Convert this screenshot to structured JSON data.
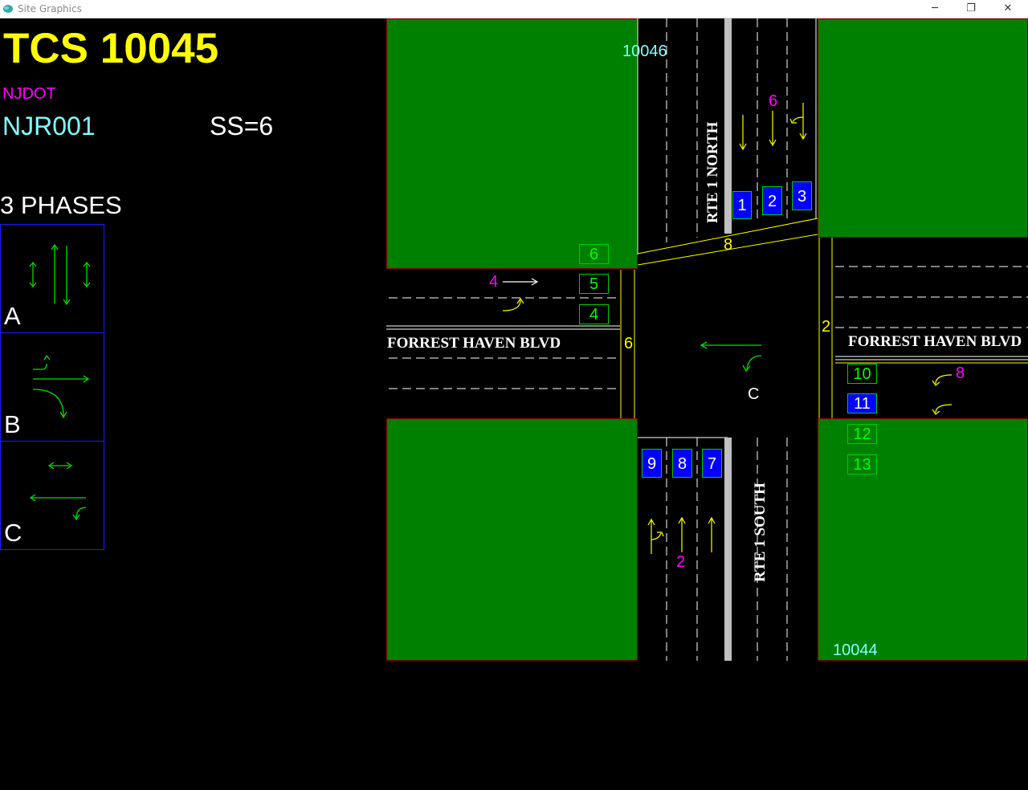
{
  "window": {
    "title": "Site Graphics",
    "minimize": "─",
    "restore": "❐",
    "close": "✕"
  },
  "header": {
    "tcs_id": "TCS 10045",
    "agency": "NJDOT",
    "route_code": "NJR001",
    "ss": "SS=6",
    "phases_title": "3 PHASES"
  },
  "phases": [
    {
      "label": "A",
      "icon": "north-south-through-arrows"
    },
    {
      "label": "B",
      "icon": "eastbound-through-left-right-arrows"
    },
    {
      "label": "C",
      "icon": "westbound-through-left-arrows"
    }
  ],
  "intersection": {
    "neighbor_north": "10046",
    "neighbor_south": "10044",
    "streets": {
      "north": "RTE 1 NORTH",
      "south": "RTE 1 SOUTH",
      "west": "FORREST HAVEN BLVD",
      "east": "FORREST HAVEN BLVD"
    },
    "phase_numbers": {
      "north": "6",
      "south": "2",
      "west": "4",
      "east": "8"
    },
    "crosswalk_labels": {
      "north": "8",
      "west": "6",
      "east": "2"
    },
    "active_phase": "C",
    "detectors": [
      {
        "id": "1",
        "active": true
      },
      {
        "id": "2",
        "active": true
      },
      {
        "id": "3",
        "active": true
      },
      {
        "id": "4",
        "active": false
      },
      {
        "id": "5",
        "active": false
      },
      {
        "id": "6",
        "active": false
      },
      {
        "id": "7",
        "active": true
      },
      {
        "id": "8",
        "active": true
      },
      {
        "id": "9",
        "active": true
      },
      {
        "id": "10",
        "active": false
      },
      {
        "id": "11",
        "active": true
      },
      {
        "id": "12",
        "active": false
      },
      {
        "id": "13",
        "active": false
      }
    ]
  },
  "colors": {
    "tcs": "#ffff00",
    "agency": "#ff00ff",
    "route": "#80ffff",
    "lot": "#008000",
    "detector_active": "#0000ff",
    "detector_inactive": "#00ff00"
  }
}
